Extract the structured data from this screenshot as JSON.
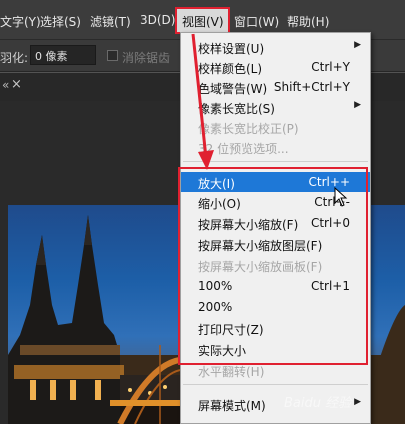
{
  "menubar": {
    "items": [
      {
        "label": "文字(Y)"
      },
      {
        "label": "选择(S)"
      },
      {
        "label": "滤镜(T)"
      },
      {
        "label": "3D(D)"
      },
      {
        "label": "视图(V)"
      },
      {
        "label": "窗口(W)"
      },
      {
        "label": "帮助(H)"
      }
    ]
  },
  "optbar": {
    "feather_label": "羽化:",
    "feather_value": "0 像素",
    "antialias_label": "消除锯齿"
  },
  "tabstrip": {
    "glyph": "«",
    "close": "×"
  },
  "menu": {
    "items": [
      {
        "label": "校样设置(U)",
        "shortcut": "",
        "submenu": true,
        "disabled": false
      },
      {
        "label": "校样颜色(L)",
        "shortcut": "Ctrl+Y",
        "submenu": false,
        "disabled": false
      },
      {
        "label": "色域警告(W)",
        "shortcut": "Shift+Ctrl+Y",
        "submenu": false,
        "disabled": false
      },
      {
        "label": "像素长宽比(S)",
        "shortcut": "",
        "submenu": true,
        "disabled": false
      },
      {
        "label": "像素长宽比校正(P)",
        "shortcut": "",
        "submenu": false,
        "disabled": true
      },
      {
        "label": "32 位预览选项...",
        "shortcut": "",
        "submenu": false,
        "disabled": true
      },
      {
        "label": "放大(I)",
        "shortcut": "Ctrl++",
        "submenu": false,
        "disabled": false,
        "highlighted": true
      },
      {
        "label": "缩小(O)",
        "shortcut": "Ctrl+-",
        "submenu": false,
        "disabled": false
      },
      {
        "label": "按屏幕大小缩放(F)",
        "shortcut": "Ctrl+0",
        "submenu": false,
        "disabled": false
      },
      {
        "label": "按屏幕大小缩放图层(F)",
        "shortcut": "",
        "submenu": false,
        "disabled": false
      },
      {
        "label": "按屏幕大小缩放画板(F)",
        "shortcut": "",
        "submenu": false,
        "disabled": true
      },
      {
        "label": "100%",
        "shortcut": "Ctrl+1",
        "submenu": false,
        "disabled": false
      },
      {
        "label": "200%",
        "shortcut": "",
        "submenu": false,
        "disabled": false
      },
      {
        "label": "打印尺寸(Z)",
        "shortcut": "",
        "submenu": false,
        "disabled": false
      },
      {
        "label": "实际大小",
        "shortcut": "",
        "submenu": false,
        "disabled": false
      },
      {
        "label": "水平翻转(H)",
        "shortcut": "",
        "submenu": false,
        "disabled": true
      },
      {
        "label": "屏幕模式(M)",
        "shortcut": "",
        "submenu": true,
        "disabled": false
      }
    ]
  },
  "watermark": "Baidu 经验",
  "colors": {
    "accent_red": "#e02030",
    "highlight_blue": "#1e78d7"
  }
}
